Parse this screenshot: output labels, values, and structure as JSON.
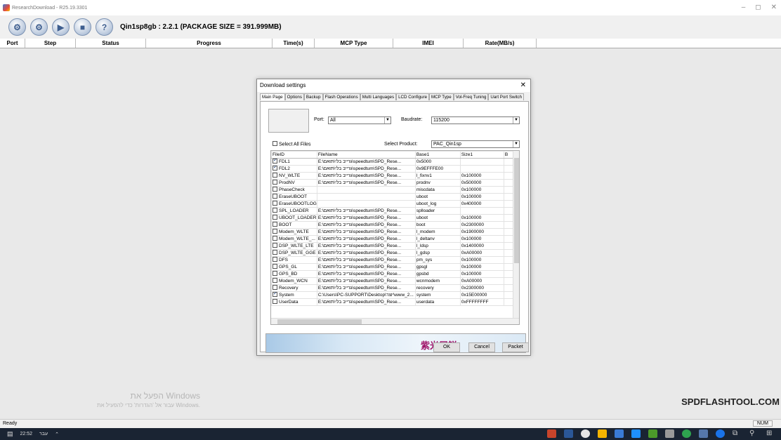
{
  "window": {
    "title": "ResearchDownload - R25.19.3301",
    "controls": [
      "–",
      "◻",
      "✕"
    ]
  },
  "toolbar": {
    "package_info": "Qin1sp8gb : 2.2.1 (PACKAGE SIZE = 391.999MB)",
    "icons": [
      "gear-icon",
      "settings-icon",
      "play-icon",
      "stop-icon",
      "help-icon"
    ]
  },
  "grid": {
    "columns": [
      "Port",
      "Step",
      "Status",
      "Progress",
      "Time(s)",
      "MCP Type",
      "IMEI",
      "Rate(MB/s)"
    ]
  },
  "watermark": {
    "line1": "הפעל את Windows",
    "line2": "עבור אל 'הגדרות' כדי להפעיל את Windows."
  },
  "brand": "SPDFLASHTOOL.COM",
  "status": {
    "left": "Ready",
    "num": "NUM"
  },
  "taskbar": {
    "time": "22:52",
    "lang": "עבר"
  },
  "dialog": {
    "title": "Download settings",
    "close": "✕",
    "tabs": [
      "Main Page",
      "Options",
      "Backup",
      "Flash Operations",
      "Multi Languages",
      "LCD Configure",
      "MCP Type",
      "Vol-Freq Tuning",
      "Uart Port Switch"
    ],
    "port_label": "Port:",
    "port_value": "All",
    "baud_label": "Baudrate:",
    "baud_value": "115200",
    "select_all": "Select All Files",
    "product_label": "Select Product:",
    "product_value": "PAC_Qin1sp",
    "file_columns": [
      "FileID",
      "FileName",
      "Base1",
      "Size1",
      "B"
    ],
    "files": [
      {
        "id": "FDL1",
        "checked": true,
        "name": "E:\\גרייב בלי\\תואם\\speedtum\\SPD_Rese...",
        "base": "0x5000",
        "size": ""
      },
      {
        "id": "FDL2",
        "checked": true,
        "name": "E:\\גרייב בלי\\תואם\\speedtum\\SPD_Rese...",
        "base": "0x9EFFFE00",
        "size": ""
      },
      {
        "id": "NV_WLTE",
        "checked": false,
        "name": "E:\\גרייב בלי\\תואם\\speedtum\\SPD_Rese...",
        "base": "l_fixnv1",
        "size": "0x100000"
      },
      {
        "id": "ProdNV",
        "checked": false,
        "name": "E:\\גרייב בלי\\תואם\\speedtum\\SPD_Rese...",
        "base": "prodnv",
        "size": "0x500000"
      },
      {
        "id": "PhaseCheck",
        "checked": false,
        "name": "",
        "base": "miscdata",
        "size": "0x100000"
      },
      {
        "id": "EraseUBOOT",
        "checked": false,
        "name": "",
        "base": "uboot",
        "size": "0x100000"
      },
      {
        "id": "EraseUBOOTLOG",
        "checked": false,
        "name": "",
        "base": "uboot_log",
        "size": "0x400000"
      },
      {
        "id": "SPL_LOADER",
        "checked": false,
        "name": "E:\\גרייב בלי\\תואם\\speedtum\\SPD_Rese...",
        "base": "splloader",
        "size": ""
      },
      {
        "id": "UBOOT_LOADER",
        "checked": false,
        "name": "E:\\גרייב בלי\\תואם\\speedtum\\SPD_Rese...",
        "base": "uboot",
        "size": "0x100000"
      },
      {
        "id": "BOOT",
        "checked": false,
        "name": "E:\\גרייב בלי\\תואם\\speedtum\\SPD_Rese...",
        "base": "boot",
        "size": "0x2300000"
      },
      {
        "id": "Modem_WLTE",
        "checked": false,
        "name": "E:\\גרייב בלי\\תואם\\speedtum\\SPD_Rese...",
        "base": "l_modem",
        "size": "0x1900000"
      },
      {
        "id": "Modem_WLTE_...",
        "checked": false,
        "name": "E:\\גרייב בלי\\תואם\\speedtum\\SPD_Rese...",
        "base": "l_deltanv",
        "size": "0x100000"
      },
      {
        "id": "DSP_WLTE_LTE",
        "checked": false,
        "name": "E:\\גרייב בלי\\תואם\\speedtum\\SPD_Rese...",
        "base": "l_ldsp",
        "size": "0x1400000"
      },
      {
        "id": "DSP_WLTE_GGE",
        "checked": false,
        "name": "E:\\גרייב בלי\\תואם\\speedtum\\SPD_Rese...",
        "base": "l_gdsp",
        "size": "0xA00000"
      },
      {
        "id": "DFS",
        "checked": false,
        "name": "E:\\גרייב בלי\\תואם\\speedtum\\SPD_Rese...",
        "base": "pm_sys",
        "size": "0x100000"
      },
      {
        "id": "GPS_GL",
        "checked": false,
        "name": "E:\\גרייב בלי\\תואם\\speedtum\\SPD_Rese...",
        "base": "gpsgl",
        "size": "0x100000"
      },
      {
        "id": "GPS_BD",
        "checked": false,
        "name": "E:\\גרייב בלי\\תואם\\speedtum\\SPD_Rese...",
        "base": "gpsbd",
        "size": "0x100000"
      },
      {
        "id": "Modem_WCN",
        "checked": false,
        "name": "E:\\גרייב בלי\\תואם\\speedtum\\SPD_Rese...",
        "base": "wcnmodem",
        "size": "0xA00000"
      },
      {
        "id": "Recovery",
        "checked": false,
        "name": "E:\\גרייב בלי\\תואם\\speedtum\\SPD_Rese...",
        "base": "recovery",
        "size": "0x2300000"
      },
      {
        "id": "System",
        "checked": true,
        "name": "C:\\Users\\PC-SUPPORT\\Desktop\\יוצר\\www_2...",
        "base": "system",
        "size": "0x15E00000"
      },
      {
        "id": "UserData",
        "checked": false,
        "name": "E:\\גרייב בלי\\תואם\\speedtum\\SPD_Rese...",
        "base": "userdata",
        "size": "0xFFFFFFFF"
      }
    ],
    "banner_logo": "紫光展锐",
    "ok": "OK",
    "cancel": "Cancel",
    "packet": "Packet"
  }
}
